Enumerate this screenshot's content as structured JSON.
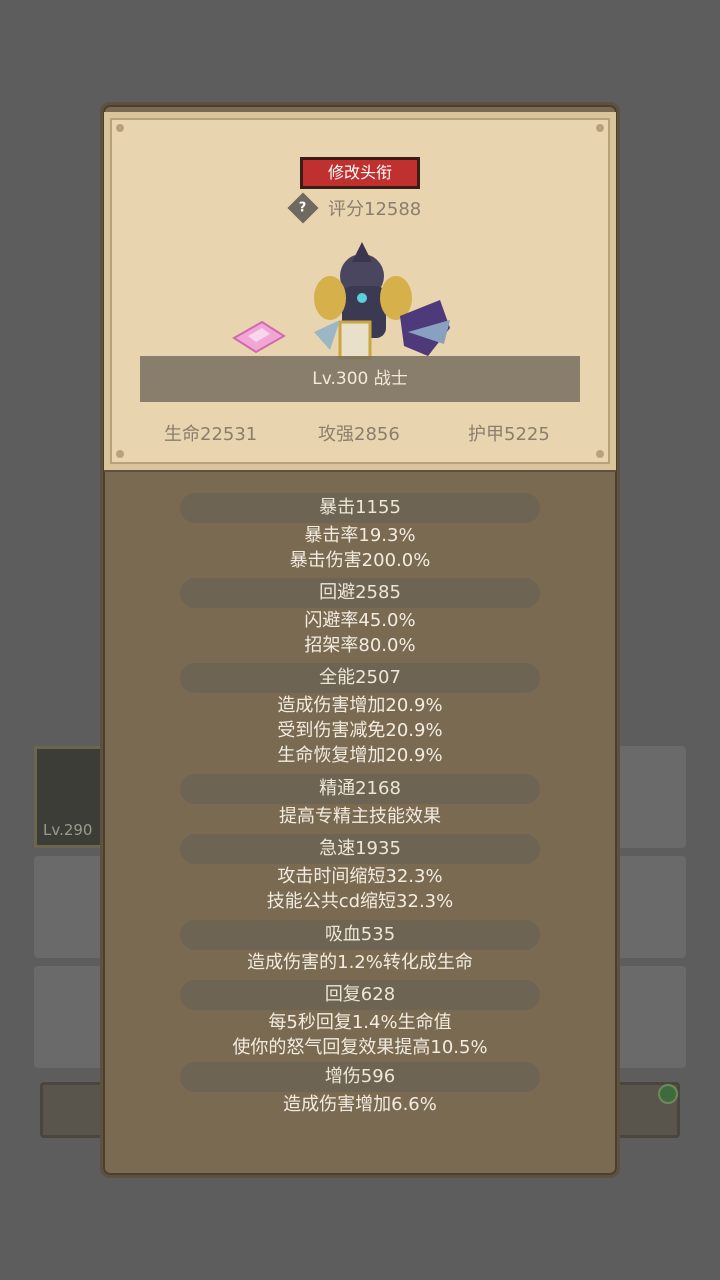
{
  "background": {
    "thumb_level": "Lv.290"
  },
  "card": {
    "rename_label": "修改头衔",
    "help_icon_text": "?",
    "score": "评分12588",
    "class_label": "Lv.300 战士",
    "stats": {
      "hp": "生命22531",
      "attack": "攻强2856",
      "armor": "护甲5225"
    }
  },
  "attributes": [
    {
      "header": "暴击1155",
      "lines": [
        "暴击率19.3%",
        "暴击伤害200.0%"
      ]
    },
    {
      "header": "回避2585",
      "lines": [
        "闪避率45.0%",
        "招架率80.0%"
      ]
    },
    {
      "header": "全能2507",
      "lines": [
        "造成伤害增加20.9%",
        "受到伤害减免20.9%",
        "生命恢复增加20.9%"
      ]
    },
    {
      "header": "精通2168",
      "lines": [
        "提高专精主技能效果"
      ]
    },
    {
      "header": "急速1935",
      "lines": [
        "攻击时间缩短32.3%",
        "技能公共cd缩短32.3%"
      ]
    },
    {
      "header": "吸血535",
      "lines": [
        "造成伤害的1.2%转化成生命"
      ]
    },
    {
      "header": "回复628",
      "lines": [
        "每5秒回复1.4%生命值",
        "使你的怒气回复效果提高10.5%"
      ]
    },
    {
      "header": "增伤596",
      "lines": [
        "造成伤害增加6.6%"
      ]
    }
  ],
  "colors": {
    "rename_button": "#c0302e",
    "card": "#e8d5b0",
    "modal": "#7a6a52"
  }
}
